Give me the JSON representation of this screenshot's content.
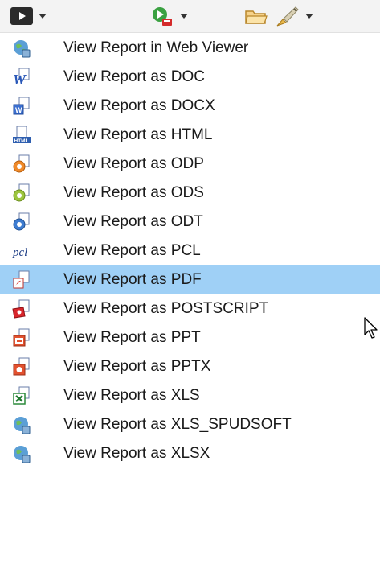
{
  "menu": {
    "items": [
      {
        "label": "View Report in Web Viewer",
        "icon": "web-viewer-icon"
      },
      {
        "label": "View Report as DOC",
        "icon": "doc-icon"
      },
      {
        "label": "View Report as DOCX",
        "icon": "docx-icon"
      },
      {
        "label": "View Report as HTML",
        "icon": "html-icon"
      },
      {
        "label": "View Report as ODP",
        "icon": "odp-icon"
      },
      {
        "label": "View Report as ODS",
        "icon": "ods-icon"
      },
      {
        "label": "View Report as ODT",
        "icon": "odt-icon"
      },
      {
        "label": "View Report as PCL",
        "icon": "pcl-icon"
      },
      {
        "label": "View Report as PDF",
        "icon": "pdf-icon"
      },
      {
        "label": "View Report as POSTSCRIPT",
        "icon": "postscript-icon"
      },
      {
        "label": "View Report as PPT",
        "icon": "ppt-icon"
      },
      {
        "label": "View Report as PPTX",
        "icon": "pptx-icon"
      },
      {
        "label": "View Report as XLS",
        "icon": "xls-icon"
      },
      {
        "label": "View Report as XLS_SPUDSOFT",
        "icon": "xls-spudsoft-icon"
      },
      {
        "label": "View Report as XLSX",
        "icon": "xlsx-icon"
      }
    ],
    "highlighted_index": 8
  },
  "toolbar": {
    "icons": [
      "view-report-icon",
      "run-icon",
      "open-folder-icon",
      "brush-icon"
    ]
  },
  "colors": {
    "highlight": "#9fd0f6",
    "toolbar_bg": "#f3f3f3"
  }
}
